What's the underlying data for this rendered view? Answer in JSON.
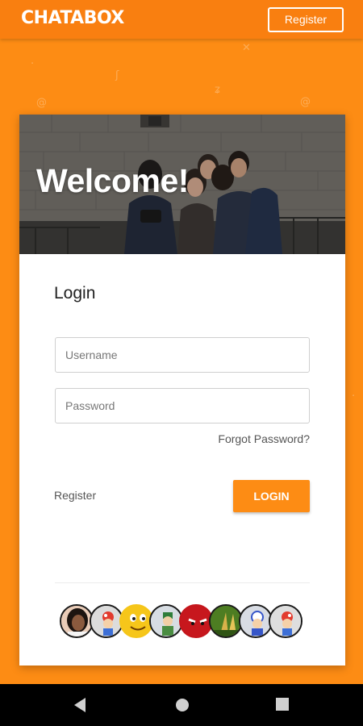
{
  "header": {
    "logo_text": "CHATABOX",
    "register_label": "Register"
  },
  "hero": {
    "title": "Welcome!"
  },
  "login": {
    "heading": "Login",
    "username_placeholder": "Username",
    "password_placeholder": "Password",
    "forgot_label": "Forgot Password?",
    "register_link": "Register",
    "login_button": "LOGIN"
  },
  "avatars": [
    {
      "name": "photo-avatar"
    },
    {
      "name": "cartoon-avatar"
    },
    {
      "name": "smiley-avatar"
    },
    {
      "name": "character-avatar"
    },
    {
      "name": "red-face-avatar"
    },
    {
      "name": "plant-avatar"
    },
    {
      "name": "cartoon-avatar"
    },
    {
      "name": "cartoon-avatar"
    }
  ],
  "colors": {
    "accent": "#fd8c14",
    "header": "#f97f10"
  },
  "navigation": {
    "back": "back-icon",
    "home": "home-icon",
    "recents": "recents-icon"
  }
}
